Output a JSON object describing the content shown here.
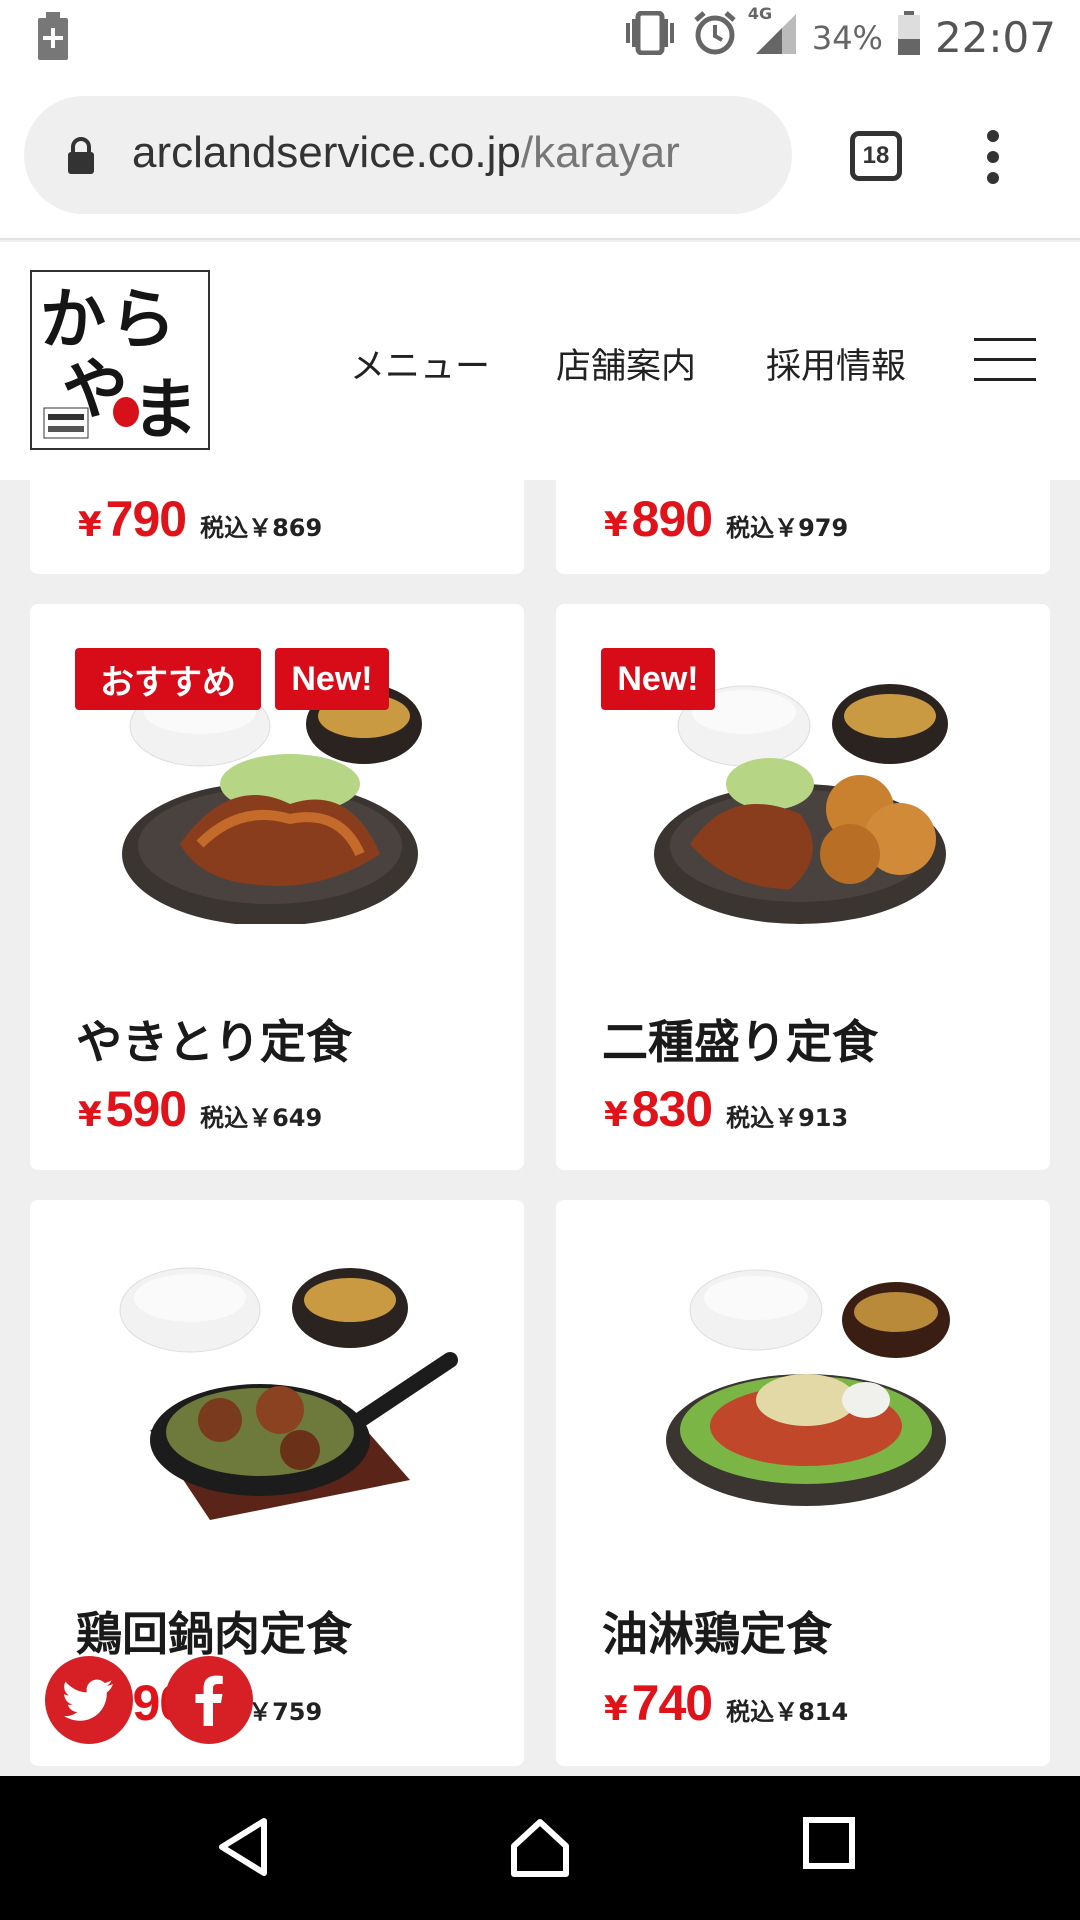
{
  "status_bar": {
    "time": "22:07",
    "battery_percent": "34%",
    "network": "4G",
    "icons": [
      "battery-saver-icon",
      "vibrate-icon",
      "alarm-icon",
      "signal-icon",
      "battery-icon"
    ]
  },
  "browser": {
    "url_domain": "arclandservice.co.jp",
    "url_path": "/karayar",
    "tab_count": "18"
  },
  "header": {
    "logo_text": "からやま",
    "logo_alt": "からやま",
    "nav": [
      "メニュー",
      "店舗案内",
      "採用情報"
    ]
  },
  "menu_items": [
    {
      "name": "",
      "yen": "¥",
      "price": "790",
      "tax": "税込￥869",
      "badges": []
    },
    {
      "name": "",
      "yen": "¥",
      "price": "890",
      "tax": "税込￥979",
      "badges": []
    },
    {
      "name": "やきとり定食",
      "yen": "¥",
      "price": "590",
      "tax": "税込￥649",
      "badges": [
        "おすすめ",
        "New!"
      ]
    },
    {
      "name": "二種盛り定食",
      "yen": "¥",
      "price": "830",
      "tax": "税込￥913",
      "badges": [
        "New!"
      ]
    },
    {
      "name": "鶏回鍋肉定食",
      "yen": "¥",
      "price": "690",
      "tax": "税込￥759",
      "badges": []
    },
    {
      "name": "油淋鶏定食",
      "yen": "¥",
      "price": "740",
      "tax": "税込￥814",
      "badges": []
    }
  ],
  "visible_partial": {
    "item5_price_fragment": "9",
    "item5_tax_fragment": "759"
  },
  "colors": {
    "accent_red": "#e0121a",
    "badge_red": "#d80c18",
    "social_red": "#d71f26"
  }
}
